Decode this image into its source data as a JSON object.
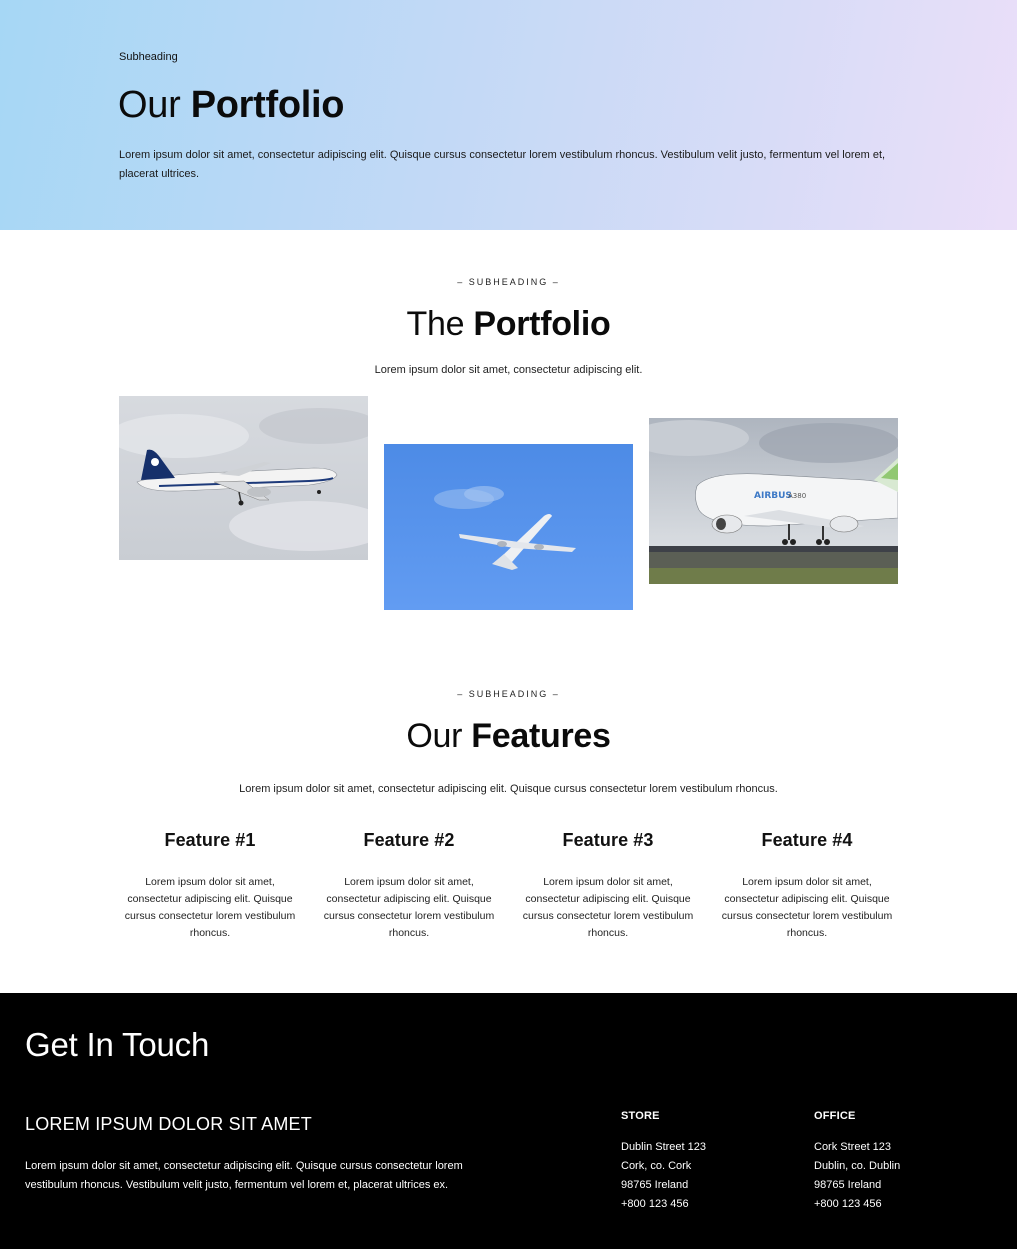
{
  "hero": {
    "subheading": "Subheading",
    "title_light": "Our",
    "title_bold": "Portfolio",
    "description": "Lorem ipsum dolor sit amet, consectetur adipiscing elit. Quisque cursus consectetur lorem vestibulum rhoncus. Vestibulum velit justo, fermentum vel lorem et, placerat ultrices."
  },
  "portfolio": {
    "kicker": "– SUBHEADING –",
    "title_light": "The",
    "title_bold": "Portfolio",
    "description": "Lorem ipsum dolor sit amet, consectetur adipiscing elit.",
    "images": [
      {
        "label": "Air New Zealand airplane in cloudy sky"
      },
      {
        "label": "Airplane in blue sky"
      },
      {
        "label": "Airbus A380 landing"
      }
    ]
  },
  "features": {
    "kicker": "– SUBHEADING –",
    "title_light": "Our",
    "title_bold": "Features",
    "description": "Lorem ipsum dolor sit amet, consectetur adipiscing elit. Quisque cursus consectetur lorem vestibulum rhoncus.",
    "items": [
      {
        "title": "Feature #1",
        "text": "Lorem ipsum dolor sit amet, consectetur adipiscing elit. Quisque cursus consectetur lorem vestibulum rhoncus."
      },
      {
        "title": "Feature #2",
        "text": "Lorem ipsum dolor sit amet, consectetur adipiscing elit. Quisque cursus consectetur lorem vestibulum rhoncus."
      },
      {
        "title": "Feature #3",
        "text": "Lorem ipsum dolor sit amet, consectetur adipiscing elit. Quisque cursus consectetur lorem vestibulum rhoncus."
      },
      {
        "title": "Feature #4",
        "text": "Lorem ipsum dolor sit amet, consectetur adipiscing elit. Quisque cursus consectetur lorem vestibulum rhoncus."
      }
    ]
  },
  "footer": {
    "title": "Get In Touch",
    "subtitle": "LOREM IPSUM DOLOR SIT AMET",
    "text": "Lorem ipsum dolor sit amet, consectetur adipiscing elit. Quisque cursus consectetur lorem vestibulum rhoncus. Vestibulum velit justo, fermentum vel lorem et, placerat ultrices ex.",
    "store": {
      "label": "STORE",
      "lines": [
        "Dublin Street 123",
        "Cork, co. Cork",
        "98765 Ireland",
        "+800 123 456"
      ]
    },
    "office": {
      "label": "OFFICE",
      "lines": [
        "Cork Street 123",
        "Dublin, co. Dublin",
        "98765 Ireland",
        "+800 123 456"
      ]
    }
  },
  "colors": {
    "footer_bg": "#000000",
    "hero_gradient_start": "#a6d7f5",
    "hero_gradient_end": "#ebdff9"
  }
}
